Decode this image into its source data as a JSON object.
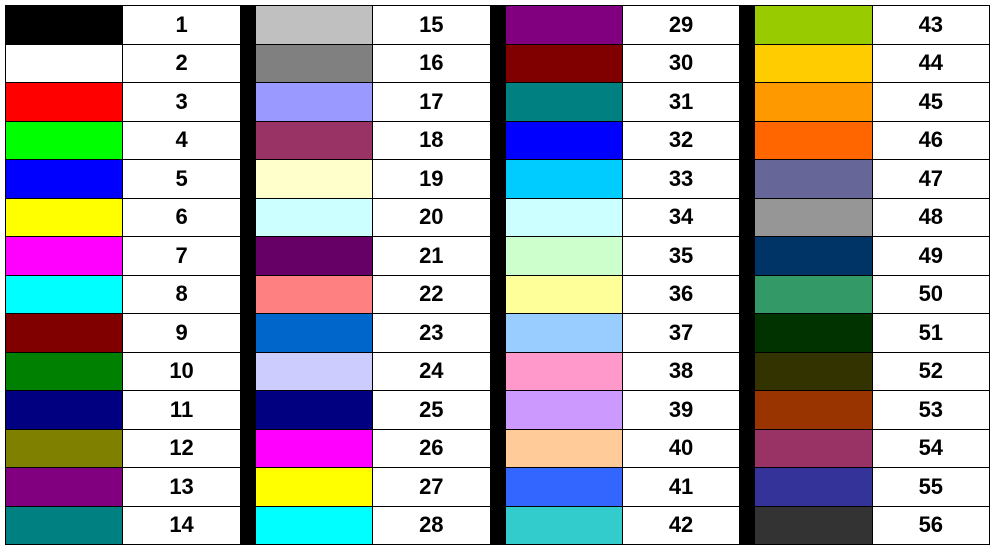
{
  "palette": {
    "columns": 4,
    "rowsPerColumn": 14,
    "entries": [
      {
        "index": 1,
        "color": "#000000"
      },
      {
        "index": 2,
        "color": "#ffffff"
      },
      {
        "index": 3,
        "color": "#ff0000"
      },
      {
        "index": 4,
        "color": "#00ff00"
      },
      {
        "index": 5,
        "color": "#0000ff"
      },
      {
        "index": 6,
        "color": "#ffff00"
      },
      {
        "index": 7,
        "color": "#ff00ff"
      },
      {
        "index": 8,
        "color": "#00ffff"
      },
      {
        "index": 9,
        "color": "#800000"
      },
      {
        "index": 10,
        "color": "#008000"
      },
      {
        "index": 11,
        "color": "#000080"
      },
      {
        "index": 12,
        "color": "#808000"
      },
      {
        "index": 13,
        "color": "#800080"
      },
      {
        "index": 14,
        "color": "#008080"
      },
      {
        "index": 15,
        "color": "#c0c0c0"
      },
      {
        "index": 16,
        "color": "#808080"
      },
      {
        "index": 17,
        "color": "#9999ff"
      },
      {
        "index": 18,
        "color": "#993366"
      },
      {
        "index": 19,
        "color": "#ffffcc"
      },
      {
        "index": 20,
        "color": "#ccffff"
      },
      {
        "index": 21,
        "color": "#660066"
      },
      {
        "index": 22,
        "color": "#ff8080"
      },
      {
        "index": 23,
        "color": "#0066cc"
      },
      {
        "index": 24,
        "color": "#ccccff"
      },
      {
        "index": 25,
        "color": "#000080"
      },
      {
        "index": 26,
        "color": "#ff00ff"
      },
      {
        "index": 27,
        "color": "#ffff00"
      },
      {
        "index": 28,
        "color": "#00ffff"
      },
      {
        "index": 29,
        "color": "#800080"
      },
      {
        "index": 30,
        "color": "#800000"
      },
      {
        "index": 31,
        "color": "#008080"
      },
      {
        "index": 32,
        "color": "#0000ff"
      },
      {
        "index": 33,
        "color": "#00ccff"
      },
      {
        "index": 34,
        "color": "#ccffff"
      },
      {
        "index": 35,
        "color": "#ccffcc"
      },
      {
        "index": 36,
        "color": "#ffff99"
      },
      {
        "index": 37,
        "color": "#99ccff"
      },
      {
        "index": 38,
        "color": "#ff99cc"
      },
      {
        "index": 39,
        "color": "#cc99ff"
      },
      {
        "index": 40,
        "color": "#ffcc99"
      },
      {
        "index": 41,
        "color": "#3366ff"
      },
      {
        "index": 42,
        "color": "#33cccc"
      },
      {
        "index": 43,
        "color": "#99cc00"
      },
      {
        "index": 44,
        "color": "#ffcc00"
      },
      {
        "index": 45,
        "color": "#ff9900"
      },
      {
        "index": 46,
        "color": "#ff6600"
      },
      {
        "index": 47,
        "color": "#666699"
      },
      {
        "index": 48,
        "color": "#969696"
      },
      {
        "index": 49,
        "color": "#003366"
      },
      {
        "index": 50,
        "color": "#339966"
      },
      {
        "index": 51,
        "color": "#003300"
      },
      {
        "index": 52,
        "color": "#333300"
      },
      {
        "index": 53,
        "color": "#993300"
      },
      {
        "index": 54,
        "color": "#993366"
      },
      {
        "index": 55,
        "color": "#333399"
      },
      {
        "index": 56,
        "color": "#333333"
      }
    ]
  }
}
